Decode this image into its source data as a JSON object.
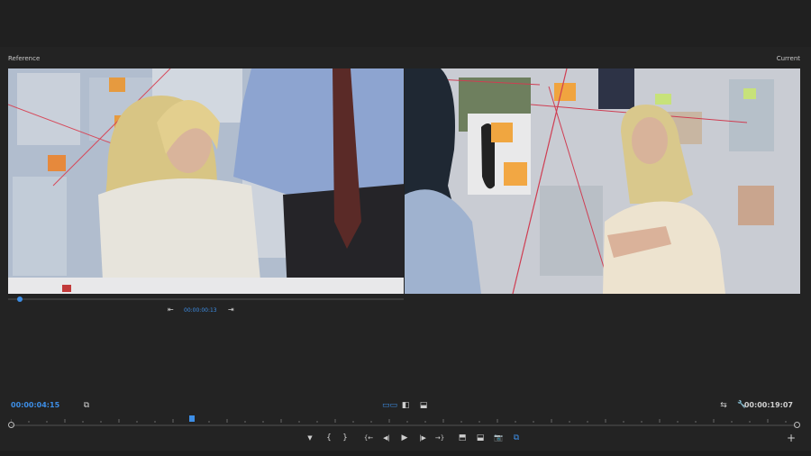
{
  "labels": {
    "reference": "Reference",
    "current": "Current"
  },
  "reference_controls": {
    "timecode": "00:00:00:13",
    "step_back_icon": "⇤",
    "step_forward_icon": "⇥"
  },
  "timecodes": {
    "left": "00:00:04:15",
    "right": "00:00:19:07"
  },
  "view_icons": {
    "compare": "▭▭",
    "split_vertical": "◧",
    "split_horizontal": "⬓",
    "compare_icon_left": "⧉",
    "swap": "⇆",
    "wrench": "🔧"
  },
  "transport": {
    "marker": "▼",
    "mark_in": "{",
    "mark_out": "}",
    "go_to_in": "{←",
    "step_back": "◀|",
    "play": "▶",
    "step_forward": "|▶",
    "go_to_out": "→}",
    "insert": "⬒",
    "overwrite": "⬓",
    "camera": "📷",
    "comparison_view": "⧉",
    "add": "+"
  },
  "colors": {
    "accent": "#3d8ee6",
    "background": "#232323"
  }
}
